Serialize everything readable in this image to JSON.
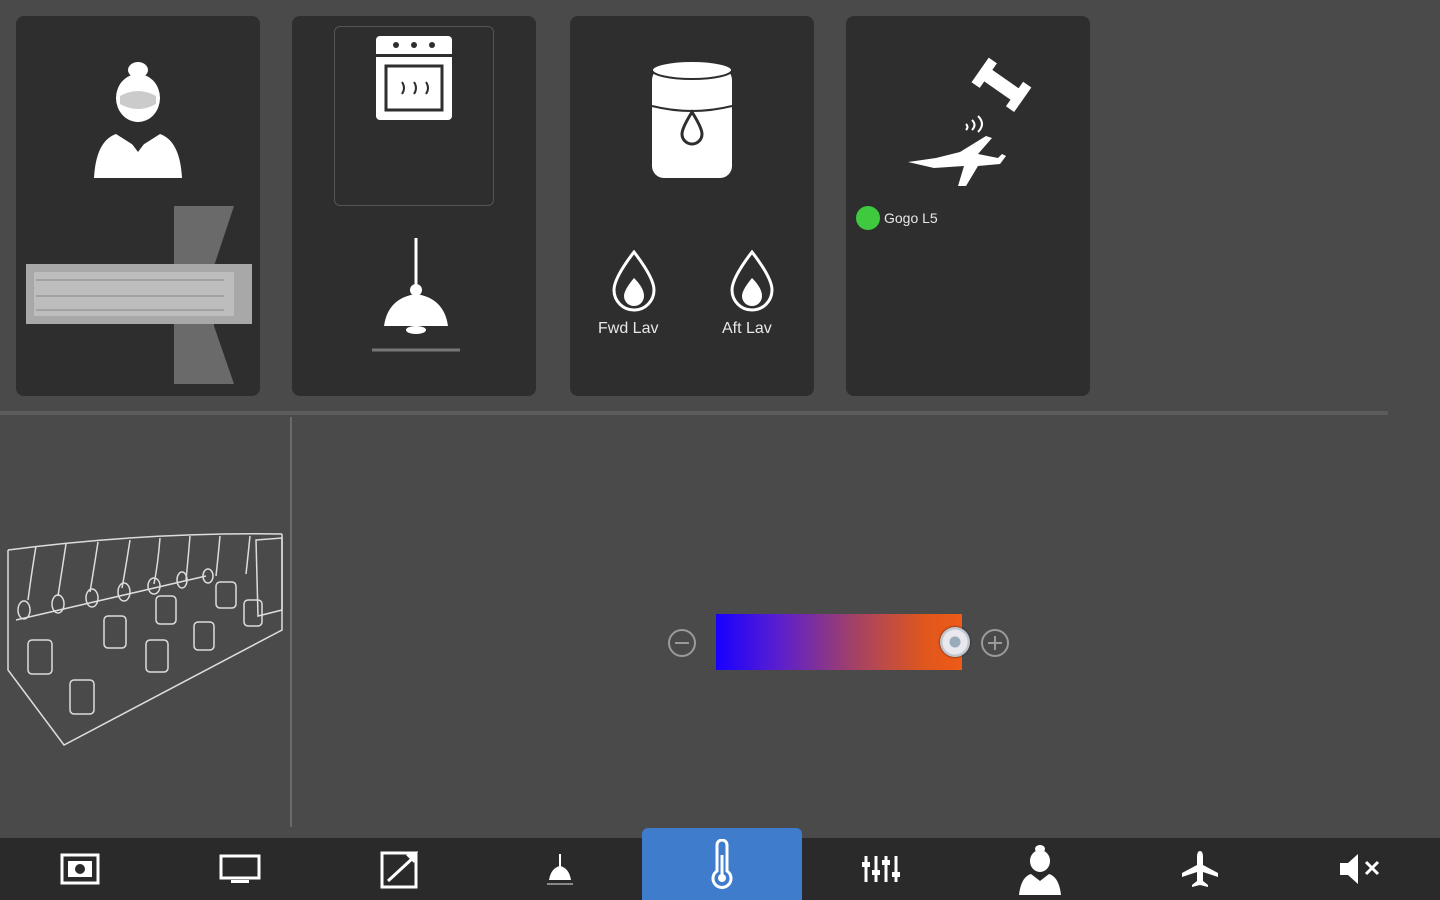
{
  "cards": {
    "crew": {
      "title": ""
    },
    "galley": {
      "title": ""
    },
    "water": {
      "fwd_lav_label": "Fwd Lav",
      "aft_lav_label": "Aft Lav"
    },
    "connectivity": {
      "status_label": "Gogo L5",
      "status_color": "#3ec93e"
    }
  },
  "temperature": {
    "level_fraction": 0.97,
    "minus_icon": "minus-circle-icon",
    "plus_icon": "plus-circle-icon"
  },
  "navbar": {
    "items": [
      {
        "icon": "media-frame-icon",
        "active": false
      },
      {
        "icon": "monitor-icon",
        "active": false
      },
      {
        "icon": "window-shade-icon",
        "active": false
      },
      {
        "icon": "lamp-icon",
        "active": false
      },
      {
        "icon": "thermometer-icon",
        "active": true
      },
      {
        "icon": "audio-mixer-icon",
        "active": false
      },
      {
        "icon": "attendant-icon",
        "active": false
      },
      {
        "icon": "airplane-icon",
        "active": false
      },
      {
        "icon": "mute-icon",
        "active": false
      }
    ],
    "active_color": "#3f7ccc"
  }
}
